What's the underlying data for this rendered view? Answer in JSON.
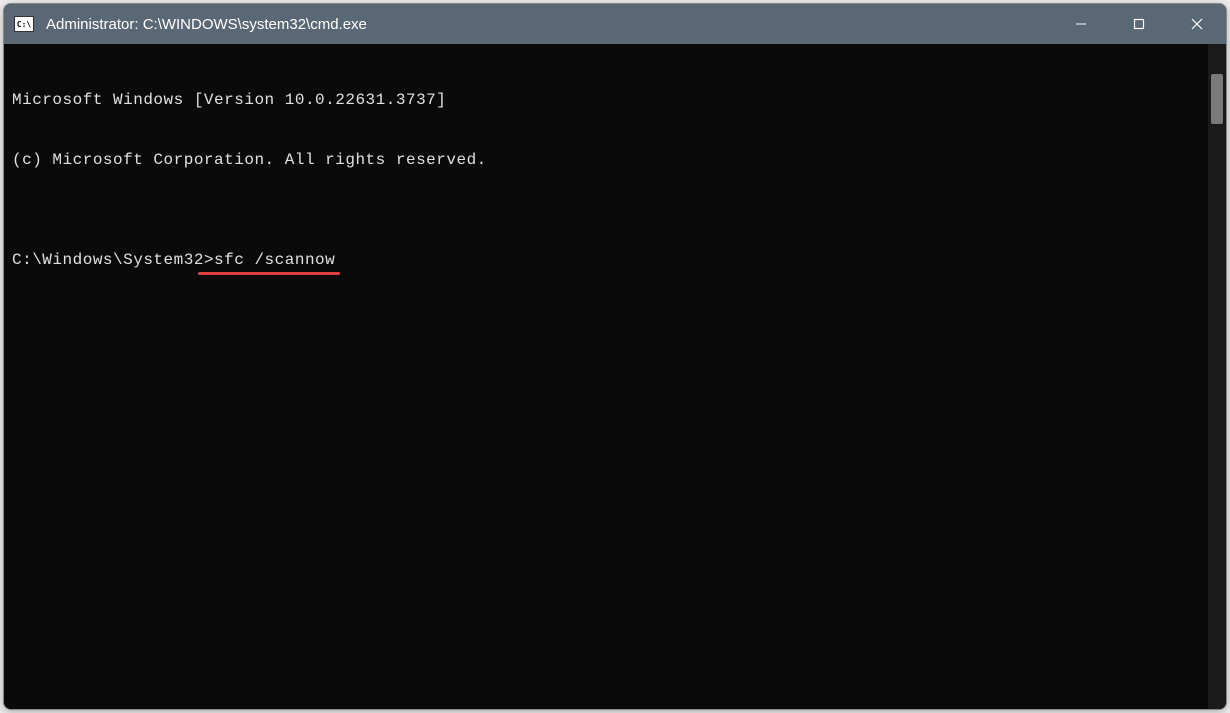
{
  "titlebar": {
    "icon_label": "C:\\",
    "title": "Administrator: C:\\WINDOWS\\system32\\cmd.exe"
  },
  "terminal": {
    "line1": "Microsoft Windows [Version 10.0.22631.3737]",
    "line2": "(c) Microsoft Corporation. All rights reserved.",
    "blank": "",
    "prompt": "C:\\Windows\\System32>",
    "command": "sfc /scannow"
  },
  "annotation": {
    "underline_color": "#e04040"
  }
}
